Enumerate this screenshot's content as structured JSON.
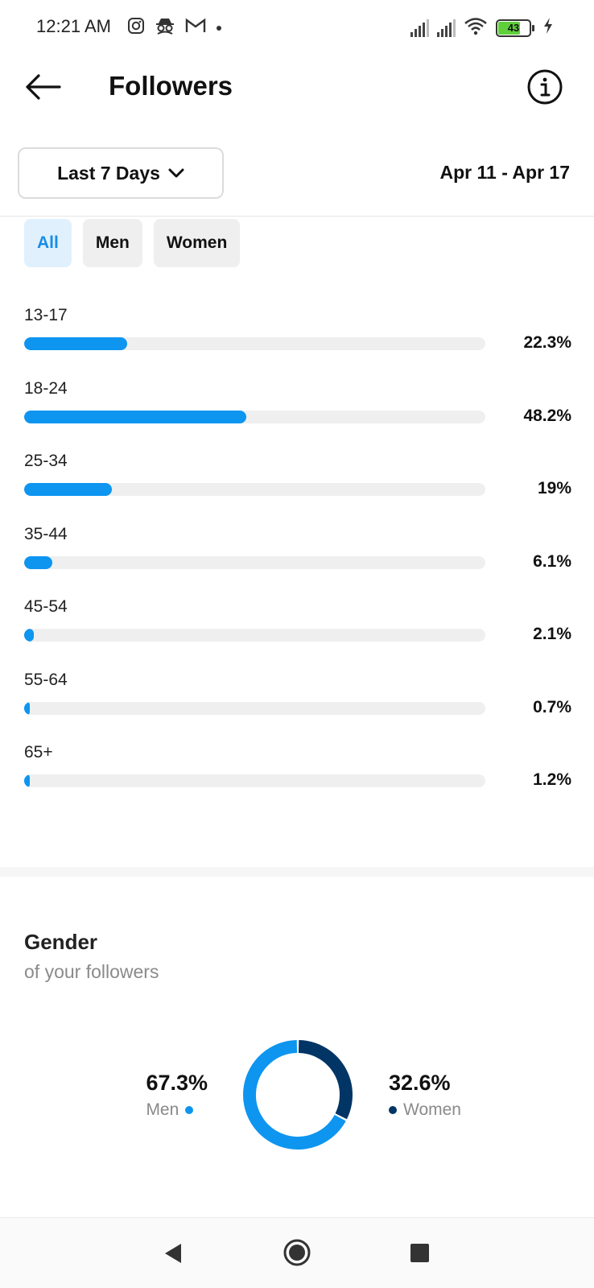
{
  "status_bar": {
    "time": "12:21 AM",
    "left_icons": [
      "instagram-icon",
      "incognito-icon",
      "gmail-icon",
      "dot-icon"
    ],
    "battery_level": "43"
  },
  "header": {
    "title": "Followers",
    "back_icon": "arrow-left-icon",
    "info_icon": "info-icon"
  },
  "range": {
    "selected": "Last 7 Days",
    "date_range": "Apr 11 - Apr 17"
  },
  "filters": [
    {
      "label": "All",
      "active": true
    },
    {
      "label": "Men",
      "active": false
    },
    {
      "label": "Women",
      "active": false
    }
  ],
  "age_ranges": [
    {
      "label": "13-17",
      "pct_text": "22.3%",
      "value": 22.3
    },
    {
      "label": "18-24",
      "pct_text": "48.2%",
      "value": 48.2
    },
    {
      "label": "25-34",
      "pct_text": "19%",
      "value": 19
    },
    {
      "label": "35-44",
      "pct_text": "6.1%",
      "value": 6.1
    },
    {
      "label": "45-54",
      "pct_text": "2.1%",
      "value": 2.1
    },
    {
      "label": "55-64",
      "pct_text": "0.7%",
      "value": 0.7
    },
    {
      "label": "65+",
      "pct_text": "1.2%",
      "value": 1.2
    }
  ],
  "gender": {
    "title": "Gender",
    "subtitle": "of your followers",
    "men": {
      "pct_text": "67.3%",
      "label": "Men",
      "value": 67.3,
      "color": "#0d95f0"
    },
    "women": {
      "pct_text": "32.6%",
      "label": "Women",
      "value": 32.6,
      "color": "#013566"
    }
  },
  "colors": {
    "accent": "#0d95f0",
    "women": "#013566",
    "track": "#efefef"
  }
}
